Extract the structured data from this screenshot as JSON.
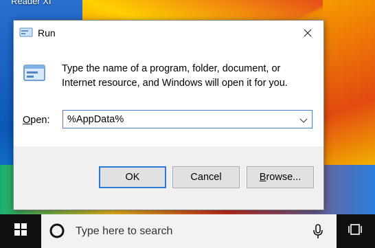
{
  "desktop": {
    "label": "Reader XI"
  },
  "dialog": {
    "title": "Run",
    "description": "Type the name of a program, folder, document, or Internet resource, and Windows will open it for you.",
    "open_label_prefix": "O",
    "open_label_rest": "pen:",
    "open_value": "%AppData%",
    "buttons": {
      "ok": "OK",
      "cancel": "Cancel",
      "browse_prefix": "B",
      "browse_rest": "rowse..."
    },
    "icons": {
      "title": "run-app-icon",
      "main": "run-app-icon",
      "close": "close-icon",
      "dropdown": "chevron-down-icon"
    }
  },
  "taskbar": {
    "search_placeholder": "Type here to search",
    "icons": {
      "start": "windows-logo-icon",
      "cortana": "cortana-circle-icon",
      "mic": "microphone-icon",
      "taskview": "task-view-icon"
    },
    "colors": {
      "background": "#101010",
      "search_bg": "#f2f2f2"
    }
  },
  "colors": {
    "accent": "#2a7ad6",
    "dialog_bg": "#f0f0f0"
  }
}
